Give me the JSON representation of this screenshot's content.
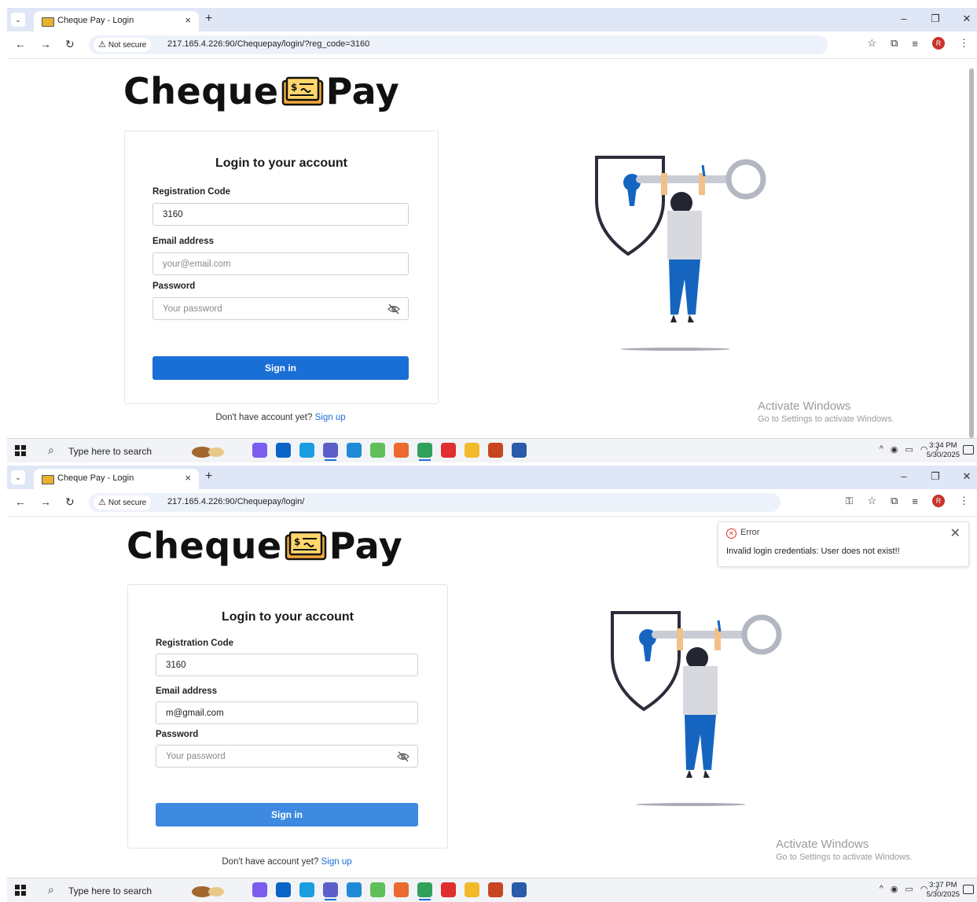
{
  "screens": [
    {
      "tab": {
        "title": "Cheque Pay - Login",
        "close": "×"
      },
      "url": {
        "security_label": "Not secure",
        "address": "217.165.4.226:90/Chequepay/login/?reg_code=3160"
      },
      "logo": {
        "left": "Cheque",
        "right": "Pay"
      },
      "form": {
        "title": "Login to your account",
        "reg_label": "Registration Code",
        "reg_value": "3160",
        "email_label": "Email address",
        "email_value": "",
        "email_placeholder": "your@email.com",
        "password_label": "Password",
        "password_placeholder": "Your password",
        "submit": "Sign in",
        "signup_prompt": "Don't have account yet?",
        "signup_link": "Sign up"
      },
      "watermark": {
        "line1": "Activate Windows",
        "line2": "Go to Settings to activate Windows."
      },
      "taskbar": {
        "search": "Type here to search",
        "time": "3:34 PM",
        "date": "5/30/2025"
      }
    },
    {
      "tab": {
        "title": "Cheque Pay - Login",
        "close": "×"
      },
      "url": {
        "security_label": "Not secure",
        "address": "217.165.4.226:90/Chequepay/login/"
      },
      "logo": {
        "left": "Cheque",
        "right": "Pay"
      },
      "form": {
        "title": "Login to your account",
        "reg_label": "Registration Code",
        "reg_value": "3160",
        "email_label": "Email address",
        "email_value": "m@gmail.com",
        "email_placeholder": "",
        "password_label": "Password",
        "password_placeholder": "Your password",
        "submit": "Sign in",
        "signup_prompt": "Don't have account yet?",
        "signup_link": "Sign up"
      },
      "toast": {
        "title": "Error",
        "message": "Invalid login credentials: User does not exist!!"
      },
      "watermark": {
        "line1": "Activate Windows",
        "line2": "Go to Settings to activate Windows."
      },
      "taskbar": {
        "search": "Type here to search",
        "time": "3:37 PM",
        "date": "5/30/2025"
      }
    }
  ],
  "colors": {
    "primary_button": "#1a6fd6",
    "link": "#1a6fd6",
    "error": "#d93025",
    "tab_strip": "#dfe7f6"
  },
  "icons": [
    "tab-list-icon",
    "cheque-favicon-icon",
    "back-arrow-icon",
    "forward-arrow-icon",
    "reload-icon",
    "warning-icon",
    "star-icon",
    "extensions-icon",
    "reading-list-icon",
    "more-icon",
    "password-key-icon",
    "eye-off-icon",
    "error-circle-icon",
    "close-icon",
    "windows-start-icon",
    "search-icon"
  ]
}
